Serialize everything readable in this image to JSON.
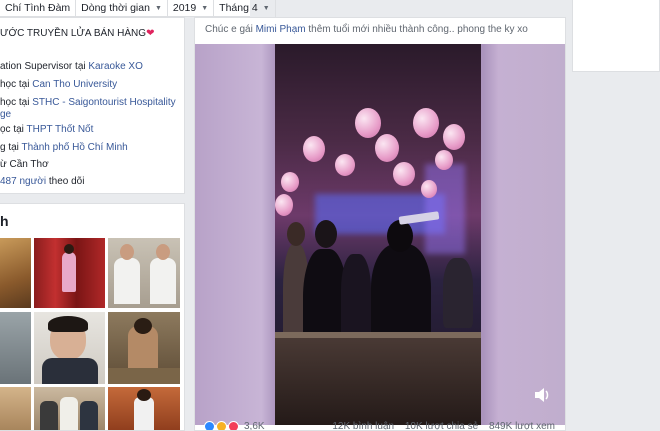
{
  "filter_bar": {
    "name": "Chí Tình Đàm",
    "timeline_label": "Dòng thời gian",
    "year": "2019",
    "month": "Tháng 4"
  },
  "intro": {
    "job_title": "ƯỚC TRUYỀN LỬA BÁN HÀNG",
    "work_prefix": "ation Supervisor tại",
    "work_place": "Karaoke XO",
    "edu1_prefix": "học tại",
    "edu1_place": "Can Tho University",
    "edu2_prefix": "học tại",
    "edu2_place": "STHC - Saigontourist Hospitality",
    "edu2_cont": "ge",
    "school_prefix": "ọc tại",
    "school_place": "THPT Thốt Nốt",
    "city_prefix": "g tại",
    "city_place": "Thành phố Hồ Chí Minh",
    "hometown": "ừ Cần Thơ",
    "followers_count": "487",
    "followers_label": "người",
    "followers_suffix": "theo dõi"
  },
  "photos": {
    "title": "h"
  },
  "post": {
    "caption_prefix": "Chúc e gái",
    "caption_name": "Mimi Phạm",
    "caption_suffix": "thêm tuổi mới nhiều thành công.. phong the ky xo",
    "reactions_count": "3,6K",
    "comments": "12K bình luận",
    "shares": "10K lượt chia sẻ",
    "views": "849K lượt xem"
  },
  "colors": {
    "link": "#385898",
    "heart": "#e0245e",
    "like": "#2d88ff",
    "haha": "#f7b125",
    "love": "#f33e58"
  },
  "icons": {
    "dropdown": "caret-down-icon",
    "volume": "speaker-icon",
    "heart": "heart-icon"
  }
}
